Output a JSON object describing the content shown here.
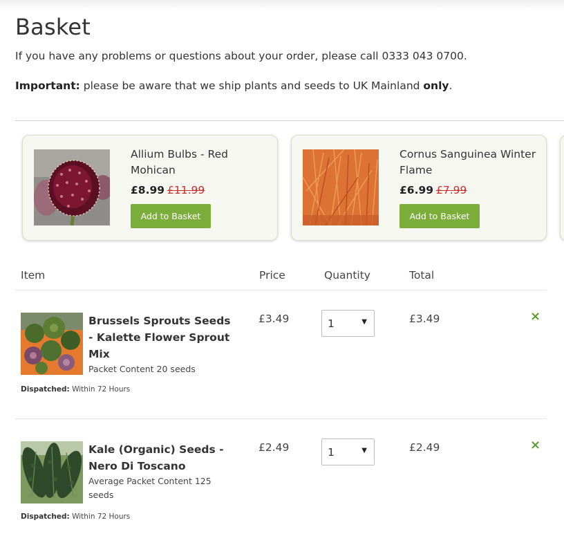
{
  "page": {
    "title": "Basket",
    "intro": "If you have any problems or questions about your order, please call 0333 043 0700.",
    "notice_prefix": "Important:",
    "notice_text": " please be aware that we ship plants and seeds to UK Mainland ",
    "notice_emph": "only",
    "notice_suffix": "."
  },
  "recommendations": [
    {
      "name": "Allium Bulbs - Red Mohican",
      "price": "£8.99",
      "was_price": "£11.99",
      "button_label": "Add to Basket",
      "icon": "allium-flower-image"
    },
    {
      "name": "Cornus Sanguinea Winter Flame",
      "price": "£6.99",
      "was_price": "£7.99",
      "button_label": "Add to Basket",
      "icon": "cornus-shrub-image"
    }
  ],
  "table": {
    "headers": {
      "item": "Item",
      "price": "Price",
      "quantity": "Quantity",
      "total": "Total"
    }
  },
  "basket_items": [
    {
      "name": "Brussels Sprouts Seeds - Kalette Flower Sprout Mix",
      "meta": "Packet Content 20 seeds",
      "dispatch_label": "Dispatched:",
      "dispatch_value": " Within 72 Hours",
      "price": "£3.49",
      "quantity": "1",
      "total": "£3.49",
      "icon": "kalette-sprouts-image"
    },
    {
      "name": "Kale (Organic) Seeds - Nero Di Toscano",
      "meta": "Average Packet Content 125 seeds",
      "dispatch_label": "Dispatched:",
      "dispatch_value": " Within 72 Hours",
      "price": "£2.49",
      "quantity": "1",
      "total": "£2.49",
      "icon": "kale-leaves-image"
    }
  ],
  "icons": {
    "remove": "×",
    "dropdown": "▼"
  },
  "colors": {
    "accent": "#7bad3a",
    "remove": "#5c9a2e",
    "was_price": "#c9302c",
    "card_bg": "#f7f7f1"
  }
}
